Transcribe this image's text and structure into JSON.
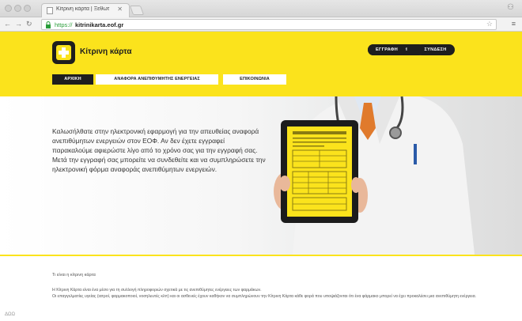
{
  "browser": {
    "tab_title": "Κίτρινη κάρτα | Ξεθωτ",
    "url_scheme": "https://",
    "url_host": "kitrinikarta.eof.gr"
  },
  "site": {
    "logo_text": "Κίτρινη κάρτα",
    "buttons": {
      "register": "ΕΓΓΡΑΦΗ",
      "login": "ΣΥΝΔΕΣΗ"
    },
    "menu": {
      "home": "ΑΡΧΙΚΗ",
      "report": "ΑΝΑΦΟΡΑ ΑΝΕΠΙΘΥΜΗΤΗΣ ΕΝΕΡΓΕΙΑΣ",
      "contact": "ΕΠΙΚΟΙΝΩΝΙΑ"
    },
    "hero_text": "Καλωσήλθατε στην ηλεκτρονική εφαρμογή για την απευθείας αναφορά ανεπιθύμητων ενεργειών στον ΕΟΦ. Αν δεν έχετε εγγραφεί παρακαλούμε αφιερώστε λίγο από το χρόνο σας για την εγγραφή σας. Μετά την εγγραφή σας μπορείτε να συνδεθείτε και να συμπληρώσετε την ηλεκτρονική φόρμα αναφοράς ανεπιθύμητων ενεργειών.",
    "section_title": "Τι είναι η κίτρινη κάρτα",
    "para1": "Η Κίτρινη Κάρτα είναι ένα μέσο για τη συλλογή πληροφοριών σχετικά με τις ανεπιθύμητες ενέργειες των φαρμάκων.",
    "para2": "Οι επαγγελματίες υγείας (ιατροί, φαρμακοποιοί, νοσηλευτές κλπ) και οι ασθενείς έχουν καθήκον να συμπληρώνουν την Κίτρινη Κάρτα κάθε φορά που υποψιάζονται ότι ένα φάρμακο μπορεί να έχει προκαλέσει μια ανεπιθύμητη ενέργεια."
  },
  "colors": {
    "brand_yellow": "#fbe31c",
    "dark": "#1e1e1e"
  }
}
